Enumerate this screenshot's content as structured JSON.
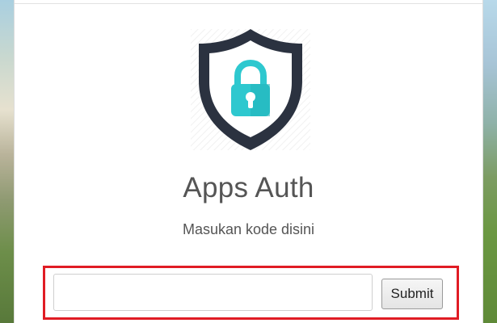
{
  "app": {
    "title": "Apps Auth",
    "subtitle": "Masukan kode disini"
  },
  "form": {
    "code_value": "",
    "code_placeholder": "",
    "submit_label": "Submit"
  },
  "icons": {
    "logo": "shield-lock-icon"
  },
  "colors": {
    "shield_dark": "#2b3240",
    "lock_teal": "#2ec8cf",
    "highlight_border": "#e01c24",
    "text_gray": "#555555"
  }
}
